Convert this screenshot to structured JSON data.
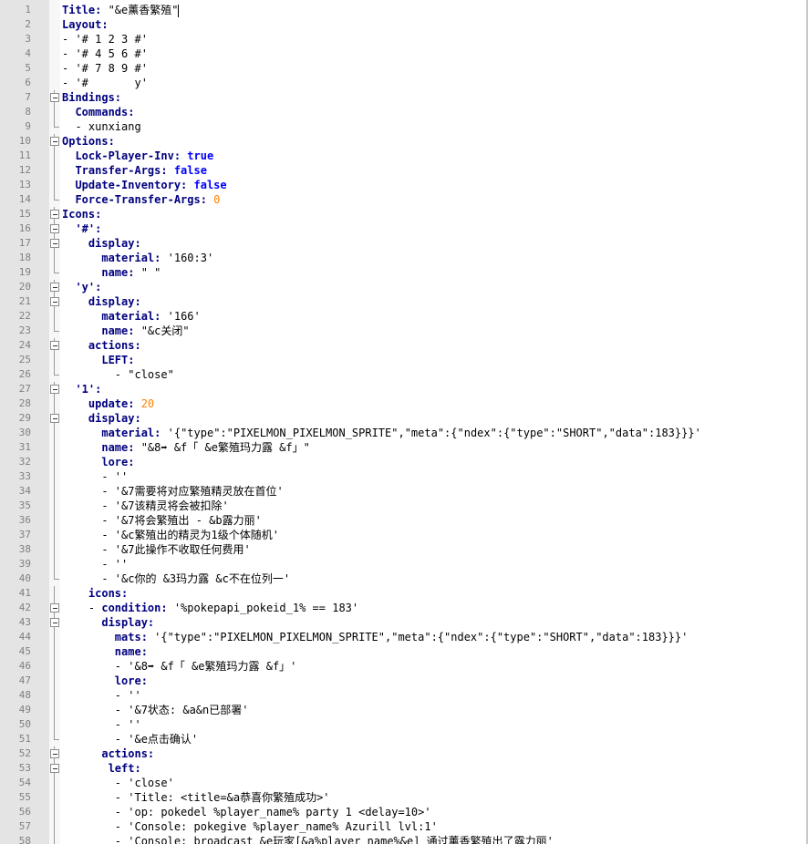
{
  "editor": {
    "lines": [
      {
        "no": "1",
        "text": "Title: \"&e薰香繁殖\"",
        "indent": 0,
        "kind": "kv",
        "key": "Title:",
        "val": " \"&e薰香繁殖\"",
        "fold": "none",
        "cursor": true,
        "hl": true
      },
      {
        "no": "2",
        "text": "Layout:",
        "indent": 0,
        "kind": "key",
        "key": "Layout:",
        "fold": "none"
      },
      {
        "no": "3",
        "text": "- '# 1 2 3 #'",
        "indent": 0,
        "kind": "plain",
        "fold": "none"
      },
      {
        "no": "4",
        "text": "- '# 4 5 6 #'",
        "indent": 0,
        "kind": "plain",
        "fold": "none"
      },
      {
        "no": "5",
        "text": "- '# 7 8 9 #'",
        "indent": 0,
        "kind": "plain",
        "fold": "none"
      },
      {
        "no": "6",
        "text": "- '#       y'",
        "indent": 0,
        "kind": "plain",
        "fold": "none"
      },
      {
        "no": "7",
        "text": "Bindings:",
        "indent": 0,
        "kind": "key",
        "key": "Bindings:",
        "fold": "box"
      },
      {
        "no": "8",
        "text": "  Commands:",
        "indent": 2,
        "kind": "key",
        "key": "Commands:",
        "fold": "line"
      },
      {
        "no": "9",
        "text": "  - xunxiang",
        "indent": 2,
        "kind": "plain",
        "fold": "end"
      },
      {
        "no": "10",
        "text": "Options:",
        "indent": 0,
        "kind": "key",
        "key": "Options:",
        "fold": "box"
      },
      {
        "no": "11",
        "text": "  Lock-Player-Inv: true",
        "indent": 2,
        "kind": "kv",
        "key": "Lock-Player-Inv:",
        "val": " true",
        "vtype": "bool",
        "fold": "line"
      },
      {
        "no": "12",
        "text": "  Transfer-Args: false",
        "indent": 2,
        "kind": "kv",
        "key": "Transfer-Args:",
        "val": " false",
        "vtype": "bool",
        "fold": "line"
      },
      {
        "no": "13",
        "text": "  Update-Inventory: false",
        "indent": 2,
        "kind": "kv",
        "key": "Update-Inventory:",
        "val": " false",
        "vtype": "bool",
        "fold": "line"
      },
      {
        "no": "14",
        "text": "  Force-Transfer-Args: 0",
        "indent": 2,
        "kind": "kv",
        "key": "Force-Transfer-Args:",
        "val": " 0",
        "vtype": "num",
        "fold": "end"
      },
      {
        "no": "15",
        "text": "Icons:",
        "indent": 0,
        "kind": "key",
        "key": "Icons:",
        "fold": "box"
      },
      {
        "no": "16",
        "text": "  '#':",
        "indent": 2,
        "kind": "key",
        "key": "'#':",
        "fold": "box"
      },
      {
        "no": "17",
        "text": "    display:",
        "indent": 4,
        "kind": "key",
        "key": "display:",
        "fold": "box"
      },
      {
        "no": "18",
        "text": "      material: '160:3'",
        "indent": 6,
        "kind": "kv",
        "key": "material:",
        "val": " '160:3'",
        "fold": "line"
      },
      {
        "no": "19",
        "text": "      name: \" \"",
        "indent": 6,
        "kind": "kv",
        "key": "name:",
        "val": " \" \"",
        "fold": "end"
      },
      {
        "no": "20",
        "text": "  'y':",
        "indent": 2,
        "kind": "key",
        "key": "'y':",
        "fold": "box"
      },
      {
        "no": "21",
        "text": "    display:",
        "indent": 4,
        "kind": "key",
        "key": "display:",
        "fold": "box"
      },
      {
        "no": "22",
        "text": "      material: '166'",
        "indent": 6,
        "kind": "kv",
        "key": "material:",
        "val": " '166'",
        "fold": "line"
      },
      {
        "no": "23",
        "text": "      name: \"&c关闭\"",
        "indent": 6,
        "kind": "kv",
        "key": "name:",
        "val": " \"&c关闭\"",
        "fold": "end"
      },
      {
        "no": "24",
        "text": "    actions:",
        "indent": 4,
        "kind": "key",
        "key": "actions:",
        "fold": "box"
      },
      {
        "no": "25",
        "text": "      LEFT:",
        "indent": 6,
        "kind": "key",
        "key": "LEFT:",
        "fold": "line"
      },
      {
        "no": "26",
        "text": "        - \"close\"",
        "indent": 8,
        "kind": "plain",
        "fold": "end"
      },
      {
        "no": "27",
        "text": "  '1':",
        "indent": 2,
        "kind": "key",
        "key": "'1':",
        "fold": "box"
      },
      {
        "no": "28",
        "text": "    update: 20",
        "indent": 4,
        "kind": "kv",
        "key": "update:",
        "val": " 20",
        "vtype": "num",
        "fold": "line"
      },
      {
        "no": "29",
        "text": "    display:",
        "indent": 4,
        "kind": "key",
        "key": "display:",
        "fold": "box"
      },
      {
        "no": "30",
        "text": "      material: '{\"type\":\"PIXELMON_PIXELMON_SPRITE\",\"meta\":{\"ndex\":{\"type\":\"SHORT\",\"data\":183}}}'",
        "indent": 6,
        "kind": "kv",
        "key": "material:",
        "val": " '{\"type\":\"PIXELMON_PIXELMON_SPRITE\",\"meta\":{\"ndex\":{\"type\":\"SHORT\",\"data\":183}}}'",
        "fold": "line"
      },
      {
        "no": "31",
        "text": "      name: \"&8➡ &f「 &e繁殖玛力露 &f」\"",
        "indent": 6,
        "kind": "kv",
        "key": "name:",
        "val": " \"&8➡ &f「 &e繁殖玛力露 &f」\"",
        "fold": "line"
      },
      {
        "no": "32",
        "text": "      lore:",
        "indent": 6,
        "kind": "key",
        "key": "lore:",
        "fold": "line"
      },
      {
        "no": "33",
        "text": "      - ''",
        "indent": 6,
        "kind": "plain",
        "fold": "line"
      },
      {
        "no": "34",
        "text": "      - '&7需要将对应繁殖精灵放在首位'",
        "indent": 6,
        "kind": "plain",
        "fold": "line"
      },
      {
        "no": "35",
        "text": "      - '&7该精灵将会被扣除'",
        "indent": 6,
        "kind": "plain",
        "fold": "line"
      },
      {
        "no": "36",
        "text": "      - '&7将会繁殖出 - &b露力丽'",
        "indent": 6,
        "kind": "plain",
        "fold": "line"
      },
      {
        "no": "37",
        "text": "      - '&c繁殖出的精灵为1级个体随机'",
        "indent": 6,
        "kind": "plain",
        "fold": "line"
      },
      {
        "no": "38",
        "text": "      - '&7此操作不收取任何费用'",
        "indent": 6,
        "kind": "plain",
        "fold": "line"
      },
      {
        "no": "39",
        "text": "      - ''",
        "indent": 6,
        "kind": "plain",
        "fold": "line"
      },
      {
        "no": "40",
        "text": "      - '&c你的 &3玛力露 &c不在位列一'",
        "indent": 6,
        "kind": "plain",
        "fold": "end"
      },
      {
        "no": "41",
        "text": "    icons:",
        "indent": 4,
        "kind": "key",
        "key": "icons:",
        "fold": "line"
      },
      {
        "no": "42",
        "text": "    - condition: '%pokepapi_pokeid_1% == 183'",
        "indent": 4,
        "kind": "dashkv",
        "key": "condition:",
        "val": " '%pokepapi_pokeid_1% == 183'",
        "fold": "box"
      },
      {
        "no": "43",
        "text": "      display:",
        "indent": 6,
        "kind": "key",
        "key": "display:",
        "fold": "box"
      },
      {
        "no": "44",
        "text": "        mats: '{\"type\":\"PIXELMON_PIXELMON_SPRITE\",\"meta\":{\"ndex\":{\"type\":\"SHORT\",\"data\":183}}}'",
        "indent": 8,
        "kind": "kv",
        "key": "mats:",
        "val": " '{\"type\":\"PIXELMON_PIXELMON_SPRITE\",\"meta\":{\"ndex\":{\"type\":\"SHORT\",\"data\":183}}}'",
        "fold": "line"
      },
      {
        "no": "45",
        "text": "        name:",
        "indent": 8,
        "kind": "key",
        "key": "name:",
        "fold": "line"
      },
      {
        "no": "46",
        "text": "        - '&8➡ &f「 &e繁殖玛力露 &f」'",
        "indent": 8,
        "kind": "plain",
        "fold": "line"
      },
      {
        "no": "47",
        "text": "        lore:",
        "indent": 8,
        "kind": "key",
        "key": "lore:",
        "fold": "line"
      },
      {
        "no": "48",
        "text": "        - ''",
        "indent": 8,
        "kind": "plain",
        "fold": "line"
      },
      {
        "no": "49",
        "text": "        - '&7状态: &a&n已部署'",
        "indent": 8,
        "kind": "plain",
        "fold": "line"
      },
      {
        "no": "50",
        "text": "        - ''",
        "indent": 8,
        "kind": "plain",
        "fold": "line"
      },
      {
        "no": "51",
        "text": "        - '&e点击确认'",
        "indent": 8,
        "kind": "plain",
        "fold": "end"
      },
      {
        "no": "52",
        "text": "      actions:",
        "indent": 6,
        "kind": "key",
        "key": "actions:",
        "fold": "box"
      },
      {
        "no": "53",
        "text": "       left:",
        "indent": 7,
        "kind": "key",
        "key": "left:",
        "fold": "box"
      },
      {
        "no": "54",
        "text": "        - 'close'",
        "indent": 8,
        "kind": "plain",
        "fold": "line"
      },
      {
        "no": "55",
        "text": "        - 'Title: <title=&a恭喜你繁殖成功>'",
        "indent": 8,
        "kind": "plain",
        "fold": "line"
      },
      {
        "no": "56",
        "text": "        - 'op: pokedel %player_name% party 1 <delay=10>'",
        "indent": 8,
        "kind": "plain",
        "fold": "line"
      },
      {
        "no": "57",
        "text": "        - 'Console: pokegive %player_name% Azurill lvl:1'",
        "indent": 8,
        "kind": "plain",
        "fold": "line"
      },
      {
        "no": "58",
        "text": "        - 'Console: broadcast &e玩家[&a%player_name%&e] 通过薰香繁殖出了露力丽'",
        "indent": 8,
        "kind": "plain",
        "fold": "line"
      }
    ]
  },
  "colors": {
    "keyword": "#000080",
    "boolean": "#0000ff",
    "number": "#ff8000",
    "gutter": "#e4e4e4",
    "line_number": "#808080"
  }
}
